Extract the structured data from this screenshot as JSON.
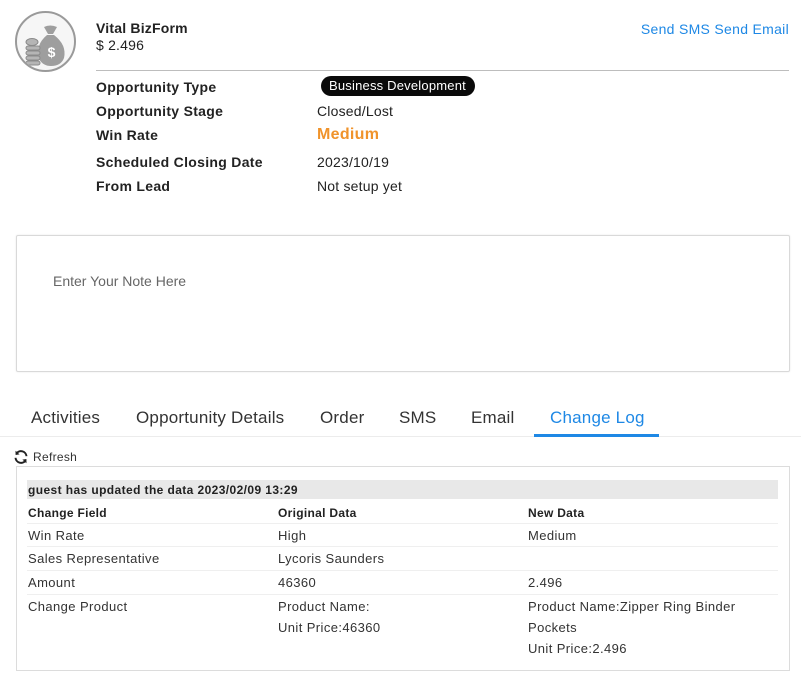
{
  "header": {
    "title": "Vital BizForm",
    "amount": "$ 2.496",
    "actions": {
      "sms": "Send SMS",
      "email": "Send Email"
    }
  },
  "info": {
    "type_label": "Opportunity Type",
    "type_value": "Business Development",
    "stage_label": "Opportunity Stage",
    "stage_value": "Closed/Lost",
    "winrate_label": "Win Rate",
    "winrate_value": "Medium",
    "closing_label": "Scheduled Closing Date",
    "closing_value": "2023/10/19",
    "lead_label": "From Lead",
    "lead_value": "Not setup yet"
  },
  "note": {
    "placeholder": "Enter Your Note Here",
    "value": ""
  },
  "tabs": [
    {
      "label": "Activities"
    },
    {
      "label": "Opportunity Details"
    },
    {
      "label": "Order"
    },
    {
      "label": "SMS"
    },
    {
      "label": "Email"
    },
    {
      "label": "Change Log"
    }
  ],
  "active_tab": "Change Log",
  "refresh_label": "Refresh",
  "change_log": {
    "header": "guest has updated the data 2023/02/09 13:29",
    "columns": [
      "Change Field",
      "Original Data",
      "New Data"
    ],
    "rows": [
      {
        "field": "Win Rate",
        "original": "High",
        "new": "Medium"
      },
      {
        "field": "Sales Representative",
        "original": "Lycoris Saunders",
        "new": ""
      },
      {
        "field": "Amount",
        "original": "46360",
        "new": "2.496"
      },
      {
        "field": "Change Product",
        "original_lines": [
          "Product Name:",
          "Unit Price:46360"
        ],
        "new_lines": [
          "Product Name:Zipper Ring Binder",
          "Pockets",
          "Unit Price:2.496"
        ]
      }
    ]
  },
  "colors": {
    "accent": "#1e88e5",
    "winrate": "#f0932b",
    "badge_bg": "#0a0a0a"
  }
}
